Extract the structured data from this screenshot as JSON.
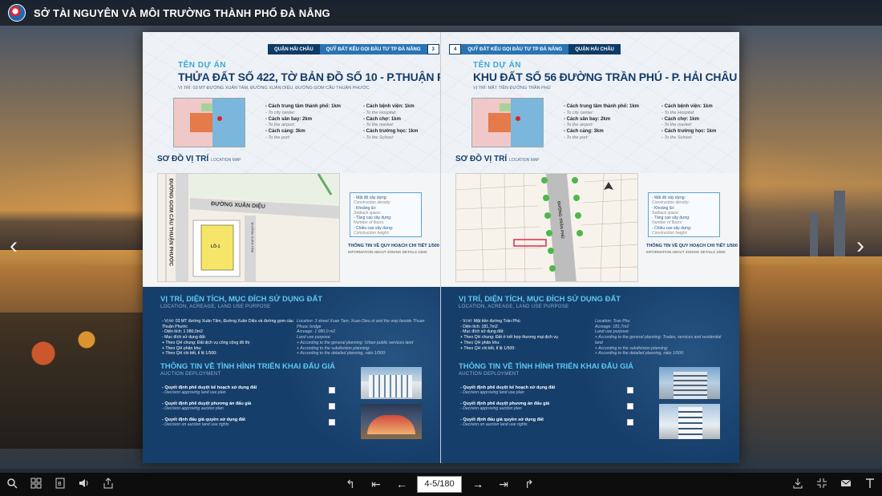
{
  "app": {
    "title": "SỞ TÀI NGUYÊN VÀ MÔI TRƯỜNG THÀNH PHỐ ĐÀ NẴNG"
  },
  "left_page": {
    "district": "QUẬN HẢI CHÂU",
    "section": "QUỸ ĐẤT KÊU GỌI ĐẦU TƯ TP ĐÀ NẴNG",
    "page_number": "3",
    "label": "TÊN DỰ ÁN",
    "name": "THỬA ĐẤT SỐ 422, TỜ BẢN ĐỒ SỐ 10 - P.THUẬN PHƯỚC",
    "address": "VỊ TRÍ: 03 MT ĐƯỜNG XUÂN TÂM, ĐƯỜNG XUÂN DIỆU, ĐƯỜNG GOM CẦU THUẬN PHƯỚC",
    "distances_col1": [
      {
        "vi": "- Cách trung tâm thành phố: 1km",
        "en": "- To city center:"
      },
      {
        "vi": "- Cách sân bay: 2km",
        "en": "- To the airport:"
      },
      {
        "vi": "- Cách cảng: 3km",
        "en": "- To the port:"
      }
    ],
    "distances_col2": [
      {
        "vi": "- Cách bệnh viện: 1km",
        "en": "- To the Hospital:"
      },
      {
        "vi": "- Cách chợ: 1km",
        "en": "- To the market:"
      },
      {
        "vi": "- Cách trường học: 1km",
        "en": "- To the School:"
      }
    ],
    "location_title": "SƠ ĐỒ VỊ TRÍ",
    "location_sub": "LOCATION MAP",
    "map_labels": [
      "ĐƯỜNG XUÂN DIỆU",
      "ĐƯỜNG GOM CẦU THUẬN PHƯỚC",
      "LÔ-1",
      "ĐƯỜNG XUÂN TÂM"
    ],
    "info_box": [
      {
        "vi": "- Mật độ xây dựng:",
        "en": "Construction density:"
      },
      {
        "vi": "- Khoảng lùi:",
        "en": "Setback space:"
      },
      {
        "vi": "- Tầng cao xây dựng:",
        "en": "Number of floors:"
      },
      {
        "vi": "- Chiều cao xây dựng:",
        "en": "Construction height:"
      }
    ],
    "info_title": "THÔNG TIN VỀ QUY HOẠCH CHI TIẾT 1/500",
    "info_sub": "INFORMATION ABOUT ZONING DETAILS 1/500",
    "usage_title": "VỊ TRÍ, DIỆN TÍCH, MỤC ĐÍCH SỬ DỤNG ĐẤT",
    "usage_sub": "LOCATION, ACREAGE, LAND USE PURPOSE",
    "usage_left": [
      "- Vị trí: 03 MT đường Xuân Tâm, Đường Xuân Diệu và đường gom cầu Thuận Phước",
      "- Diện tích: 1 080,0m2",
      "- Mục đích sử dụng đất:",
      "+ Theo QH chung: Đất dịch vụ công cộng đô thị",
      "+ Theo QH phân khu:",
      "+ Theo QH chi tiết, tỉ lệ 1/500:"
    ],
    "usage_right": [
      "Location: 3 street Xuan Tam, Xuan Dieu st and the way beside Thuan Phuoc bridge",
      "Acreage: 1 080,0 m2",
      "Land use purpose:",
      "+ According to the general planning: Urban public services land",
      "+ According to the subdivision planning:",
      "+ According to the detailed planning, ratio 1/500:"
    ],
    "auction_title": "THÔNG TIN VỀ TÌNH HÌNH TRIỂN KHAI ĐẤU GIÁ",
    "auction_sub": "AUCTION DEPLOYMENT",
    "auction_items": [
      {
        "vi": "- Quyết định phê duyệt kế hoạch sử dụng đất",
        "en": "- Decision approving land use plan"
      },
      {
        "vi": "- Quyết định phê duyệt phương án đấu giá",
        "en": "- Decision approving auction plan"
      },
      {
        "vi": "- Quyết định đấu giá quyền sử dụng đất",
        "en": "- Decision on auction land use rights"
      }
    ]
  },
  "right_page": {
    "page_number": "4",
    "section": "QUỸ ĐẤT KÊU GỌI ĐẦU TƯ TP ĐÀ NẴNG",
    "district": "QUẬN HẢI CHÂU",
    "label": "TÊN DỰ ÁN",
    "name": "KHU ĐẤT SỐ 56 ĐƯỜNG TRẦN PHÚ - P. HẢI CHÂU 1",
    "address": "VỊ TRÍ: MẶT TIỀN ĐƯỜNG TRẦN PHÚ",
    "distances_col1": [
      {
        "vi": "- Cách trung tâm thành phố: 1km",
        "en": "- To city center:"
      },
      {
        "vi": "- Cách sân bay: 2km",
        "en": "- To the airport:"
      },
      {
        "vi": "- Cách cảng: 3km",
        "en": "- To the port:"
      }
    ],
    "distances_col2": [
      {
        "vi": "- Cách bệnh viện: 1km",
        "en": "- To the Hospital:"
      },
      {
        "vi": "- Cách chợ: 1km",
        "en": "- To the market:"
      },
      {
        "vi": "- Cách trường học: 1km",
        "en": "- To the School:"
      }
    ],
    "location_title": "SƠ ĐỒ VỊ TRÍ",
    "location_sub": "LOCATION MAP",
    "map_labels": [
      "ĐƯỜNG TRẦN PHÚ"
    ],
    "info_box": [
      {
        "vi": "- Mật độ xây dựng:",
        "en": "Construction density:"
      },
      {
        "vi": "- Khoảng lùi:",
        "en": "Setback space:"
      },
      {
        "vi": "- Tầng cao xây dựng:",
        "en": "Number of floors:"
      },
      {
        "vi": "- Chiều cao xây dựng:",
        "en": "Construction height:"
      }
    ],
    "info_title": "THÔNG TIN VỀ QUY HOẠCH CHI TIẾT 1/500",
    "info_sub": "INFORMATION ABOUT ZONING DETAILS 1/500",
    "usage_title": "VỊ TRÍ, DIỆN TÍCH, MỤC ĐÍCH SỬ DỤNG ĐẤT",
    "usage_sub": "LOCATION, ACREAGE, LAND USE PURPOSE",
    "usage_left": [
      "- Vị trí: Mặt tiền đường Trần Phú",
      "- Diện tích: 181,7m2",
      "- Mục đích sử dụng đất:",
      "+ Theo QH chung: Đất ở kết hợp thương mại dịch vụ",
      "+ Theo QH phân khu:",
      "+ Theo QH chi tiết, tỉ lệ 1/500:"
    ],
    "usage_right": [
      "Location: Tran Phu",
      "Acreage: 181,7m2",
      "Land use purpose:",
      "+ According to the general planning: Trades, services and residential land",
      "+ According to the subdivision planning:",
      "+ According to the detailed planning, ratio 1/500:"
    ],
    "auction_title": "THÔNG TIN VỀ TÌNH HÌNH TRIỂN KHAI ĐẤU GIÁ",
    "auction_sub": "AUCTION DEPLOYMENT",
    "auction_items": [
      {
        "vi": "- Quyết định phê duyệt kế hoạch sử dụng đất",
        "en": "- Decision approving land use plan"
      },
      {
        "vi": "- Quyết định phê duyệt phương án đấu giá",
        "en": "- Decision approving auction plan"
      },
      {
        "vi": "- Quyết định đấu giá quyền sử dụng đất",
        "en": "- Decision on auction land use rights"
      }
    ]
  },
  "toolbar": {
    "page_indicator": "4-5/180",
    "left_icons": [
      "zoom-icon",
      "thumbnails-icon",
      "bookmark-icon",
      "sound-icon",
      "share-icon"
    ],
    "center_icons": [
      "first-page-icon",
      "prev-chapter-icon",
      "prev-page-icon",
      "next-page-icon",
      "next-chapter-icon",
      "last-page-icon"
    ],
    "right_icons": [
      "download-icon",
      "fullscreen-icon",
      "email-icon",
      "text-icon"
    ]
  },
  "colors": {
    "navy": "#143c6a",
    "accent": "#3aa8d8",
    "panel": "#163e6a"
  }
}
